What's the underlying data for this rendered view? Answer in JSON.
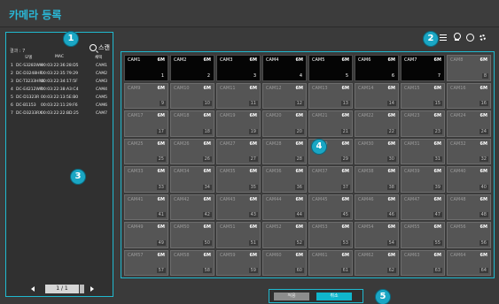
{
  "title": "카메라 등록",
  "left": {
    "result_label": "결과 : 7",
    "scan_label": "스캔",
    "columns": [
      "모델",
      "MAC",
      "채택"
    ],
    "rows": [
      {
        "idx": "1",
        "model": "DC-S3283WH",
        "mac": "00:03:22:36:28:D5",
        "cam": "CAM1"
      },
      {
        "idx": "2",
        "model": "DC-D3248HR",
        "mac": "00:03:22:35:79:29",
        "cam": "CAM2"
      },
      {
        "idx": "3",
        "model": "DC-T3233HRX",
        "mac": "00:03:22:34:17:5F",
        "cam": "CAM3"
      },
      {
        "idx": "4",
        "model": "DC-E4212WR",
        "mac": "00:03:22:38:A3:C4",
        "cam": "CAM4"
      },
      {
        "idx": "5",
        "model": "DC-D1323R",
        "mac": "00:03:22:13:5E:B0",
        "cam": "CAM5"
      },
      {
        "idx": "6",
        "model": "DC-B1153",
        "mac": "00:03:22:11:29:F6",
        "cam": "CAM6"
      },
      {
        "idx": "7",
        "model": "DC-D3233RX",
        "mac": "00:03:22:22:BD:25",
        "cam": "CAM7"
      }
    ],
    "page_text": "1 / 1"
  },
  "grid": [
    {
      "name": "CAM1",
      "res": "6M",
      "num": "1",
      "active": true
    },
    {
      "name": "CAM2",
      "res": "6M",
      "num": "2",
      "active": true
    },
    {
      "name": "CAM3",
      "res": "6M",
      "num": "3",
      "active": true
    },
    {
      "name": "CAM4",
      "res": "6M",
      "num": "4",
      "active": true
    },
    {
      "name": "CAM5",
      "res": "6M",
      "num": "5",
      "active": true
    },
    {
      "name": "CAM6",
      "res": "6M",
      "num": "6",
      "active": true
    },
    {
      "name": "CAM7",
      "res": "6M",
      "num": "7",
      "active": true
    },
    {
      "name": "CAM8",
      "res": "6M",
      "num": "8",
      "active": false
    },
    {
      "name": "CAM9",
      "res": "6M",
      "num": "9",
      "active": false
    },
    {
      "name": "CAM10",
      "res": "6M",
      "num": "10",
      "active": false
    },
    {
      "name": "CAM11",
      "res": "6M",
      "num": "11",
      "active": false
    },
    {
      "name": "CAM12",
      "res": "6M",
      "num": "12",
      "active": false
    },
    {
      "name": "CAM13",
      "res": "6M",
      "num": "13",
      "active": false
    },
    {
      "name": "CAM14",
      "res": "6M",
      "num": "14",
      "active": false
    },
    {
      "name": "CAM15",
      "res": "6M",
      "num": "15",
      "active": false
    },
    {
      "name": "CAM16",
      "res": "6M",
      "num": "16",
      "active": false
    },
    {
      "name": "CAM17",
      "res": "6M",
      "num": "17",
      "active": false
    },
    {
      "name": "CAM18",
      "res": "6M",
      "num": "18",
      "active": false
    },
    {
      "name": "CAM19",
      "res": "6M",
      "num": "19",
      "active": false
    },
    {
      "name": "CAM20",
      "res": "6M",
      "num": "20",
      "active": false
    },
    {
      "name": "CAM21",
      "res": "6M",
      "num": "21",
      "active": false
    },
    {
      "name": "CAM22",
      "res": "6M",
      "num": "22",
      "active": false
    },
    {
      "name": "CAM23",
      "res": "6M",
      "num": "23",
      "active": false
    },
    {
      "name": "CAM24",
      "res": "6M",
      "num": "24",
      "active": false
    },
    {
      "name": "CAM25",
      "res": "6M",
      "num": "25",
      "active": false
    },
    {
      "name": "CAM26",
      "res": "6M",
      "num": "26",
      "active": false
    },
    {
      "name": "CAM27",
      "res": "6M",
      "num": "27",
      "active": false
    },
    {
      "name": "CAM28",
      "res": "6M",
      "num": "28",
      "active": false
    },
    {
      "name": "CAM29",
      "res": "6M",
      "num": "29",
      "active": false
    },
    {
      "name": "CAM30",
      "res": "6M",
      "num": "30",
      "active": false
    },
    {
      "name": "CAM31",
      "res": "6M",
      "num": "31",
      "active": false
    },
    {
      "name": "CAM32",
      "res": "6M",
      "num": "32",
      "active": false
    },
    {
      "name": "CAM33",
      "res": "6M",
      "num": "33",
      "active": false
    },
    {
      "name": "CAM34",
      "res": "6M",
      "num": "34",
      "active": false
    },
    {
      "name": "CAM35",
      "res": "6M",
      "num": "35",
      "active": false
    },
    {
      "name": "CAM36",
      "res": "6M",
      "num": "36",
      "active": false
    },
    {
      "name": "CAM37",
      "res": "6M",
      "num": "37",
      "active": false
    },
    {
      "name": "CAM38",
      "res": "6M",
      "num": "38",
      "active": false
    },
    {
      "name": "CAM39",
      "res": "6M",
      "num": "39",
      "active": false
    },
    {
      "name": "CAM40",
      "res": "6M",
      "num": "40",
      "active": false
    },
    {
      "name": "CAM41",
      "res": "6M",
      "num": "41",
      "active": false
    },
    {
      "name": "CAM42",
      "res": "6M",
      "num": "42",
      "active": false
    },
    {
      "name": "CAM43",
      "res": "6M",
      "num": "43",
      "active": false
    },
    {
      "name": "CAM44",
      "res": "6M",
      "num": "44",
      "active": false
    },
    {
      "name": "CAM45",
      "res": "6M",
      "num": "45",
      "active": false
    },
    {
      "name": "CAM46",
      "res": "6M",
      "num": "46",
      "active": false
    },
    {
      "name": "CAM47",
      "res": "6M",
      "num": "47",
      "active": false
    },
    {
      "name": "CAM48",
      "res": "6M",
      "num": "48",
      "active": false
    },
    {
      "name": "CAM49",
      "res": "6M",
      "num": "49",
      "active": false
    },
    {
      "name": "CAM50",
      "res": "6M",
      "num": "50",
      "active": false
    },
    {
      "name": "CAM51",
      "res": "6M",
      "num": "51",
      "active": false
    },
    {
      "name": "CAM52",
      "res": "6M",
      "num": "52",
      "active": false
    },
    {
      "name": "CAM53",
      "res": "6M",
      "num": "53",
      "active": false
    },
    {
      "name": "CAM54",
      "res": "6M",
      "num": "54",
      "active": false
    },
    {
      "name": "CAM55",
      "res": "6M",
      "num": "55",
      "active": false
    },
    {
      "name": "CAM56",
      "res": "6M",
      "num": "56",
      "active": false
    },
    {
      "name": "CAM57",
      "res": "6M",
      "num": "57",
      "active": false
    },
    {
      "name": "CAM58",
      "res": "6M",
      "num": "58",
      "active": false
    },
    {
      "name": "CAM59",
      "res": "6M",
      "num": "59",
      "active": false
    },
    {
      "name": "CAM60",
      "res": "6M",
      "num": "60",
      "active": false
    },
    {
      "name": "CAM61",
      "res": "6M",
      "num": "61",
      "active": false
    },
    {
      "name": "CAM62",
      "res": "6M",
      "num": "62",
      "active": false
    },
    {
      "name": "CAM63",
      "res": "6M",
      "num": "63",
      "active": false
    },
    {
      "name": "CAM64",
      "res": "6M",
      "num": "64",
      "active": false
    }
  ],
  "footer": {
    "apply_label": "적용",
    "cancel_label": "취소"
  },
  "badges": [
    "1",
    "2",
    "3",
    "4",
    "5"
  ],
  "colors": {
    "accent": "#20b9cf",
    "title": "#2ab7d6"
  }
}
